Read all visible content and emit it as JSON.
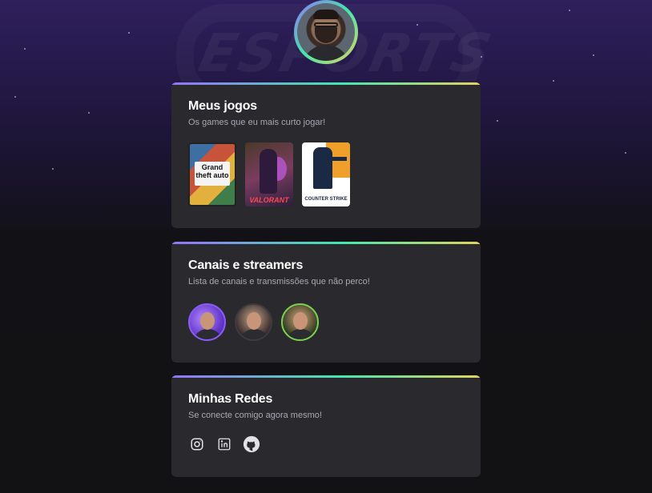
{
  "background": {
    "logo_text": "ESPORTS"
  },
  "profile": {
    "avatar_alt": "Foto de perfil"
  },
  "sections": {
    "games": {
      "title": "Meus jogos",
      "subtitle": "Os games que eu mais curto jogar!",
      "items": [
        {
          "name": "Grand Theft Auto V",
          "logo_text": "Grand theft auto"
        },
        {
          "name": "Valorant",
          "logo_text": "VALORANT"
        },
        {
          "name": "Counter-Strike",
          "logo_text": "COUNTER STRIKE"
        }
      ]
    },
    "channels": {
      "title": "Canais e streamers",
      "subtitle": "Lista de canais e transmissões que não perco!",
      "items": [
        {
          "border_color": "#8a5cf5"
        },
        {
          "border_color": "#3b3b40"
        },
        {
          "border_color": "#7ad14f"
        }
      ]
    },
    "socials": {
      "title": "Minhas Redes",
      "subtitle": "Se conecte comigo agora mesmo!",
      "items": [
        {
          "icon": "instagram-icon"
        },
        {
          "icon": "linkedin-icon"
        },
        {
          "icon": "github-icon"
        }
      ]
    }
  },
  "colors": {
    "card_bg": "#29292e",
    "accent_gradient": [
      "#9572fc",
      "#43e7ad",
      "#e2d45c"
    ],
    "subtitle": "#a8a8b3"
  }
}
